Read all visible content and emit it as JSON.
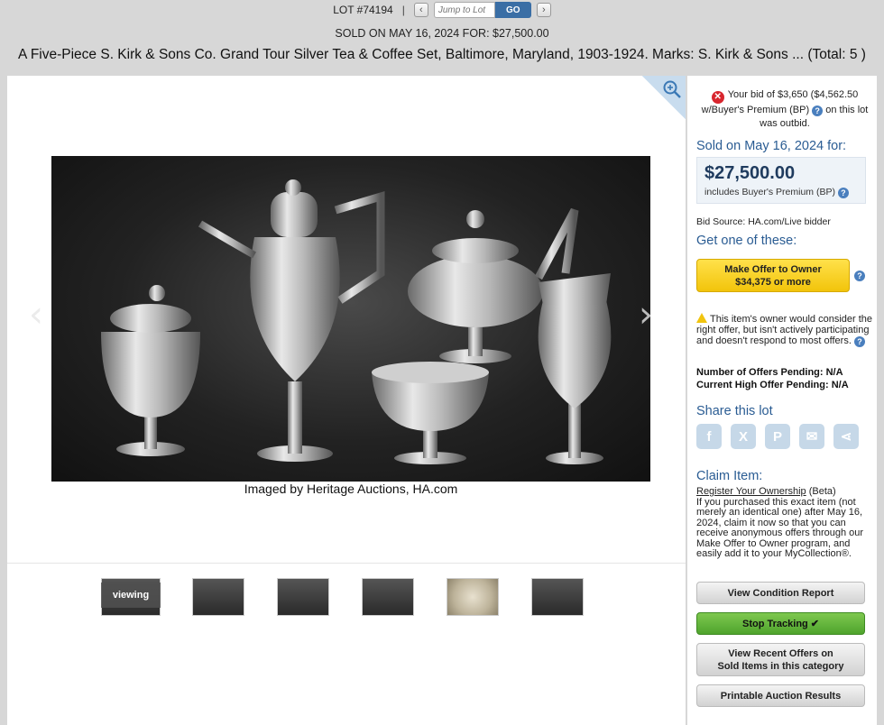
{
  "header": {
    "lot_label": "LOT #74194",
    "separator": "|",
    "jump_placeholder": "Jump to Lot",
    "go_label": "GO",
    "prev_glyph": "‹",
    "next_glyph": "›",
    "sold_line": "SOLD ON MAY 16, 2024 FOR: $27,500.00",
    "title": "A Five-Piece S. Kirk & Sons Co. Grand Tour Silver Tea & Coffee Set, Baltimore, Maryland, 1903-1924. Marks: S. Kirk & Sons ... (Total: 5 )"
  },
  "viewer": {
    "credit": "Imaged by Heritage Auctions, HA.com",
    "prev_arrow": "‹",
    "next_arrow": "›",
    "viewing_label": "viewing",
    "thumbnail_count": 6
  },
  "sidebar": {
    "outbid_text": "Your bid of $3,650 ($4,562.50 w/Buyer's Premium (BP)",
    "outbid_tail": "on this lot was outbid.",
    "sold_label": "Sold on May 16, 2024 for:",
    "price": "$27,500.00",
    "price_note": "includes Buyer's Premium (BP)",
    "bid_source": "Bid Source: HA.com/Live bidder",
    "get_one_label": "Get one of these:",
    "offer_line1": "Make Offer to Owner",
    "offer_line2": "$34,375 or more",
    "owner_note": "This item's owner would consider the right offer, but isn't actively participating and doesn't respond to most offers.",
    "offers_pending": "Number of Offers Pending: N/A",
    "high_offer": "Current High Offer Pending: N/A",
    "share_label": "Share this lot",
    "share_icons": [
      "facebook-icon",
      "x-icon",
      "pinterest-icon",
      "email-icon",
      "share-icon"
    ],
    "claim_label": "Claim Item:",
    "claim_link": "Register Your Ownership",
    "claim_beta": "(Beta)",
    "claim_body": "If you purchased this exact item (not merely an identical one) after May 16, 2024, claim it now so that you can receive anonymous offers through our Make Offer to Owner program, and easily add it to your MyCollection®.",
    "btn_condition": "View Condition Report",
    "btn_tracking": "Stop Tracking",
    "btn_recent_1": "View Recent Offers on",
    "btn_recent_2": "Sold Items in this category",
    "btn_printable": "Printable Auction Results"
  },
  "colors": {
    "page_bg": "#d7d7d7",
    "link_blue": "#2a5c93",
    "offer_yellow": "#f2c40b",
    "tracking_green": "#4fa42d",
    "outbid_red": "#d8262e"
  }
}
